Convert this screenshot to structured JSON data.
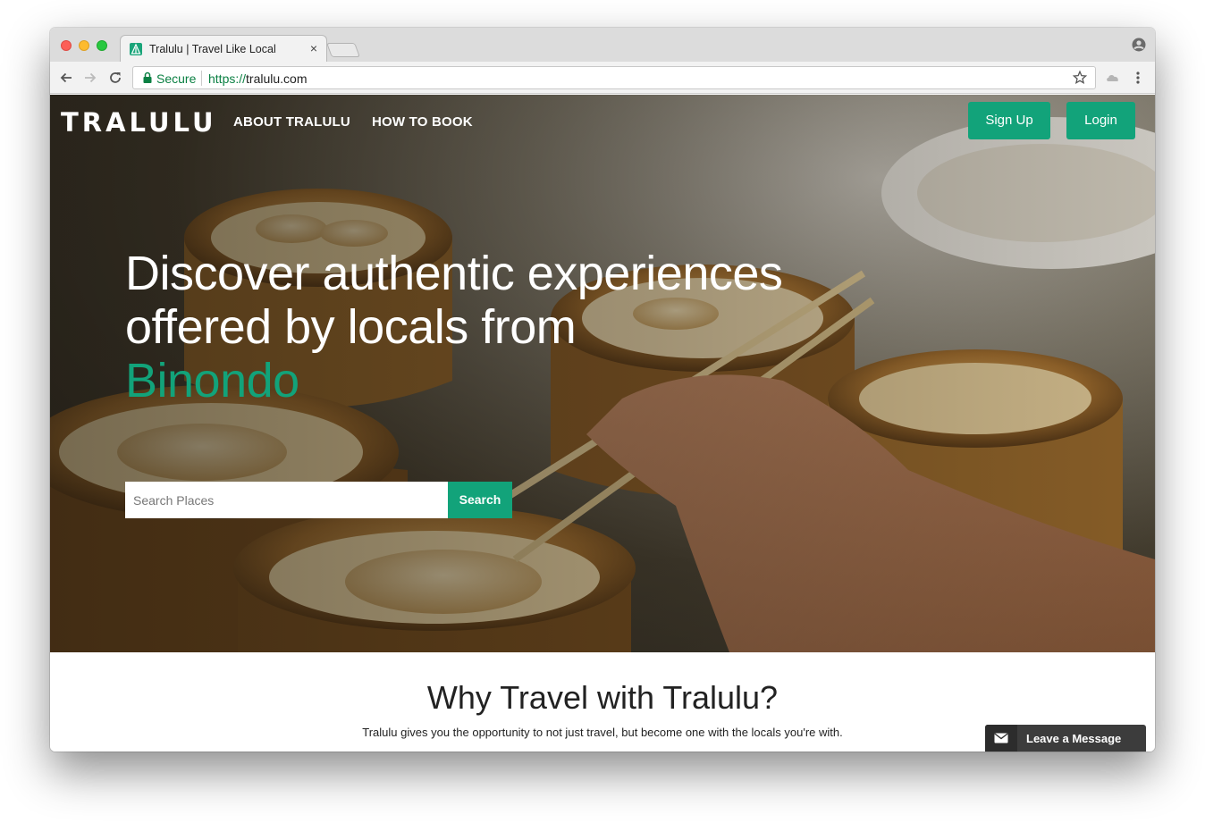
{
  "browser": {
    "tab_title": "Tralulu | Travel Like Local",
    "tab_close": "×",
    "secure_label": "Secure",
    "url_scheme": "https://",
    "url_host": "tralulu.com"
  },
  "site": {
    "logo": "TRALULU",
    "nav": {
      "about": "ABOUT TRALULU",
      "how_to_book": "HOW TO BOOK"
    },
    "signup_label": "Sign Up",
    "login_label": "Login"
  },
  "hero": {
    "headline": "Discover authentic experiences offered by locals from",
    "place": "Binondo",
    "search_placeholder": "Search Places",
    "search_button": "Search"
  },
  "why": {
    "title": "Why Travel with Tralulu?",
    "subtitle": "Tralulu gives you the opportunity to not just travel, but become one with the locals you're with."
  },
  "chat": {
    "label": "Leave a Message"
  },
  "colors": {
    "brand_green": "#12a37a",
    "secure_green": "#0b8043",
    "chat_bg": "#3c3c3c"
  },
  "icons": [
    "close-icon",
    "back-icon",
    "forward-icon",
    "reload-icon",
    "lock-icon",
    "star-icon",
    "extension-icon",
    "menu-icon",
    "profile-icon",
    "envelope-icon"
  ]
}
